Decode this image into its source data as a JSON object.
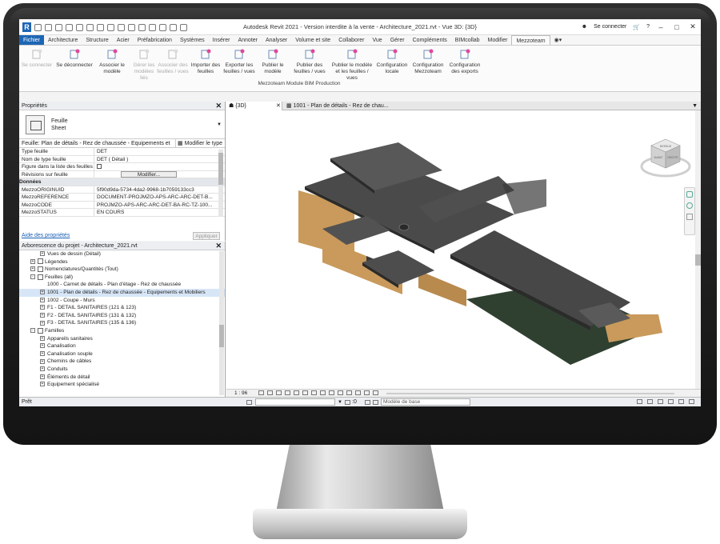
{
  "titlebar": {
    "logo": "R",
    "title": "Autodesk Revit 2021 - Version interdite à la vente - Architecture_2021.rvt - Vue 3D: {3D}",
    "sign_in": "Se connecter",
    "help": "?",
    "quick_access_icons": [
      "open-icon",
      "save-icon",
      "sync-icon",
      "undo-icon",
      "redo-icon",
      "print-icon",
      "measure-icon",
      "dimension-icon",
      "tag-icon",
      "text-icon",
      "3d-view-icon",
      "section-icon",
      "thin-lines-icon",
      "close-hidden-icon",
      "switch-windows-icon"
    ]
  },
  "tabs": [
    "Fichier",
    "Architecture",
    "Structure",
    "Acier",
    "Préfabrication",
    "Systèmes",
    "Insérer",
    "Annoter",
    "Analyser",
    "Volume et site",
    "Collaborer",
    "Vue",
    "Gérer",
    "Compléments",
    "BIMcollab",
    "Modifier",
    "Mezzoteam"
  ],
  "active_tab": "Mezzoteam",
  "ribbon": {
    "buttons": [
      {
        "label": "Se connecter",
        "disabled": true
      },
      {
        "label": "Se déconnecter",
        "disabled": false
      },
      {
        "label": "Associer le modèle",
        "disabled": false
      },
      {
        "label": "Gérer les modèles liés",
        "disabled": true
      },
      {
        "label": "Associer des feuilles / vues",
        "disabled": true
      },
      {
        "label": "Importer des feuilles",
        "disabled": false
      },
      {
        "label": "Exporter les feuilles / vues",
        "disabled": false
      },
      {
        "label": "Publier le modèle",
        "disabled": false
      },
      {
        "label": "Publier des feuilles / vues",
        "disabled": false
      },
      {
        "label": "Publier le modèle et les feuilles / vues",
        "disabled": false
      },
      {
        "label": "Configuration locale",
        "disabled": false
      },
      {
        "label": "Configuration Mezzoteam",
        "disabled": false
      },
      {
        "label": "Configuration des exports",
        "disabled": false
      }
    ],
    "panel_title": "Mezzoteam Module BIM Production"
  },
  "properties": {
    "title": "Propriétés",
    "type_line1": "Feuille",
    "type_line2": "Sheet",
    "instance_selector": "Feuille: Plan de détails - Rez de chaussée - Equipements et",
    "edit_type": "Modifier le type",
    "rows": [
      {
        "key": "Type feuille",
        "value": "DET"
      },
      {
        "key": "Nom de type feuille",
        "value": "DET ( Détail )"
      },
      {
        "key": "Figure dans la liste des feuilles",
        "value": ""
      },
      {
        "key": "Révisions sur feuille",
        "value": "Modifier..."
      }
    ],
    "section": "Données",
    "data_rows": [
      {
        "key": "MezzoORIGINUID",
        "value": "5f90d9da-5734-4da2-9968-1b7059133cc3"
      },
      {
        "key": "MezzoREFERENCE",
        "value": "DOCUMENT-PROJMZO-APS-ARC-ARC-DET-B..."
      },
      {
        "key": "MezzoCODE",
        "value": "PROJMZO-APS-ARC-ARC-DET-BA-RC-TZ-100..."
      },
      {
        "key": "MezzoSTATUS",
        "value": "EN COURS"
      }
    ],
    "help_link": "Aide des propriétés",
    "apply": "Appliquer"
  },
  "browser": {
    "title": "Arborescence du projet - Architecture_2021.rvt",
    "items": [
      {
        "label": "Vues de dessin (Détail)",
        "level": 1,
        "toggle": "+",
        "icon": false
      },
      {
        "label": "Légendes",
        "level": 0,
        "toggle": "+",
        "icon": true
      },
      {
        "label": "Nomenclatures/Quantités (Tout)",
        "level": 0,
        "toggle": "+",
        "icon": true
      },
      {
        "label": "Feuilles (all)",
        "level": 0,
        "toggle": "-",
        "icon": true
      },
      {
        "label": "1000 - Carnet de détails - Plan d'étage - Rez de chaussée",
        "level": 1,
        "toggle": "",
        "icon": false
      },
      {
        "label": "1001 - Plan  de détails - Rez de chaussée - Equipements et Mobiliers",
        "level": 1,
        "toggle": "+",
        "icon": false
      },
      {
        "label": "1002 - Coupe - Murs",
        "level": 1,
        "toggle": "+",
        "icon": false
      },
      {
        "label": "F1 - DETAIL SANITAIRES (121 & 123)",
        "level": 1,
        "toggle": "+",
        "icon": false
      },
      {
        "label": "F2 - DETAIL SANITAIRES (131 & 132)",
        "level": 1,
        "toggle": "+",
        "icon": false
      },
      {
        "label": "F3 - DETAIL SANITAIRES (135 & 136)",
        "level": 1,
        "toggle": "+",
        "icon": false
      },
      {
        "label": "Familles",
        "level": 0,
        "toggle": "-",
        "icon": true
      },
      {
        "label": "Appareils sanitaires",
        "level": 1,
        "toggle": "+",
        "icon": false
      },
      {
        "label": "Canalisation",
        "level": 1,
        "toggle": "+",
        "icon": false
      },
      {
        "label": "Canalisation souple",
        "level": 1,
        "toggle": "+",
        "icon": false
      },
      {
        "label": "Chemins de câbles",
        "level": 1,
        "toggle": "+",
        "icon": false
      },
      {
        "label": "Conduits",
        "level": 1,
        "toggle": "+",
        "icon": false
      },
      {
        "label": "Éléments de détail",
        "level": 1,
        "toggle": "+",
        "icon": false
      },
      {
        "label": "Equipement spécialisé",
        "level": 1,
        "toggle": "+",
        "icon": false
      }
    ],
    "selected_index": 5
  },
  "views": {
    "tabs": [
      "{3D}",
      "1001 - Plan  de détails - Rez de chau..."
    ],
    "active": 0,
    "viewcube": {
      "top": "DESSUS",
      "front": "AVANT",
      "right": "DROITE"
    }
  },
  "viewbar": {
    "scale": "1 : 96"
  },
  "status": {
    "text": "Prêt",
    "worksets": ":0",
    "model": "Modèle de base"
  },
  "colors": {
    "accent": "#1e66b5",
    "roof": "#4a4a4a",
    "wood": "#c99a5b",
    "glass": "#3a3a3a",
    "ground": "#2f4030"
  }
}
